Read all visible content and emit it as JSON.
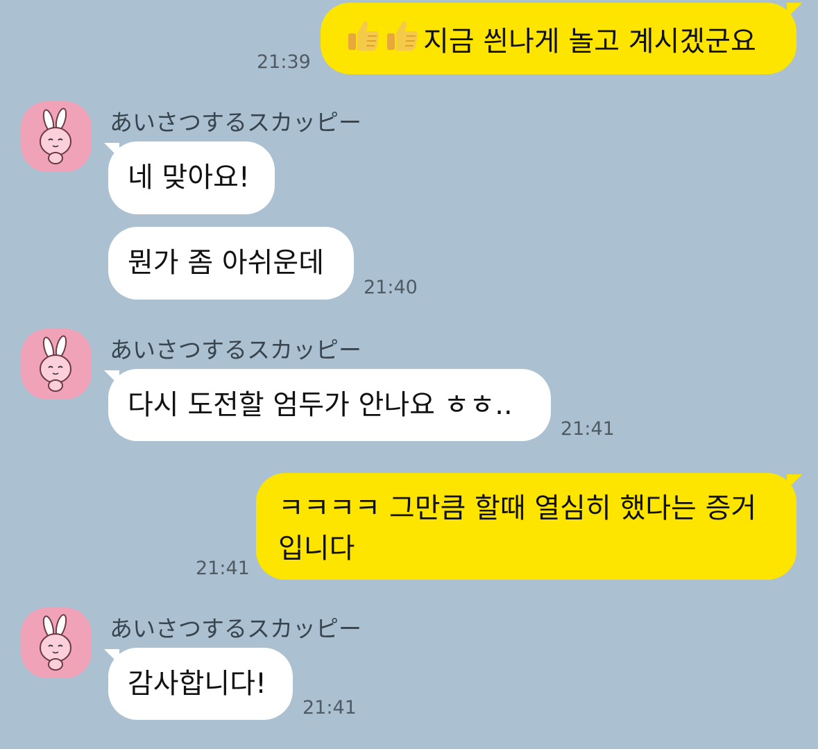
{
  "contact_name": "あいさつするスカッピー",
  "messages": [
    {
      "direction": "out",
      "emoji": [
        "thumbs-up",
        "thumbs-up"
      ],
      "text": "지금 씐나게 놀고 계시겠군요",
      "time": "21:39"
    },
    {
      "direction": "in",
      "sender": "あいさつするスカッピー",
      "text": "네 맞아요!",
      "time": ""
    },
    {
      "direction": "in",
      "text": "뭔가 좀 아쉬운데",
      "time": "21:40"
    },
    {
      "direction": "in",
      "sender": "あいさつするスカッピー",
      "text": "다시 도전할 엄두가 안나요 ㅎㅎ..",
      "time": "21:41"
    },
    {
      "direction": "out",
      "text_lines": [
        "ㅋㅋㅋㅋ 그만큼 할때 열심히 했다는 증거",
        "입니다"
      ],
      "time": "21:41"
    },
    {
      "direction": "in",
      "sender": "あいさつするスカッピー",
      "text": "감사합니다!",
      "time": "21:41"
    }
  ],
  "colors": {
    "background": "#abc1d1",
    "outgoing_bubble": "#fee500",
    "incoming_bubble": "#ffffff",
    "avatar_bg": "#f0a3b8"
  }
}
